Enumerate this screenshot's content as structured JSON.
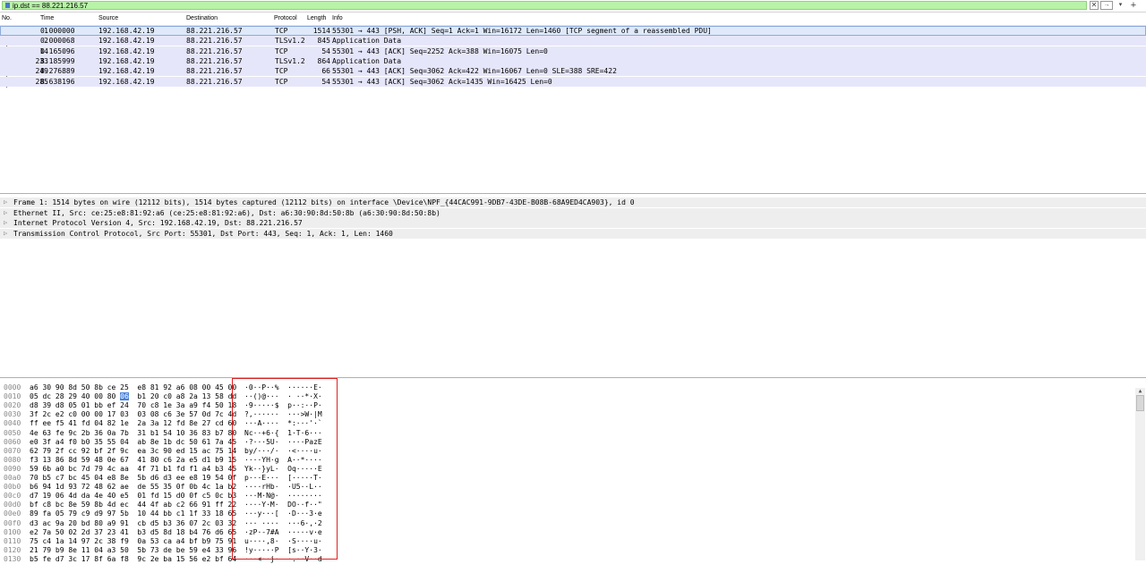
{
  "filter": {
    "value": "ip.dst == 88.221.216.57",
    "clear_label": "✕",
    "apply_label": "→",
    "dropdown_label": "▾",
    "add_label": "+"
  },
  "packet_list": {
    "headers": {
      "no": "No.",
      "time": "Time",
      "source": "Source",
      "destination": "Destination",
      "protocol": "Protocol",
      "length": "Length",
      "info": "Info"
    },
    "rows": [
      {
        "no": "1",
        "time": "0.000000",
        "source": "192.168.42.19",
        "destination": "88.221.216.57",
        "protocol": "TCP",
        "length": "1514",
        "info": "55301 → 443 [PSH, ACK] Seq=1 Ack=1 Win=16172 Len=1460 [TCP segment of a reassembled PDU]"
      },
      {
        "no": "2",
        "time": "0.000068",
        "source": "192.168.42.19",
        "destination": "88.221.216.57",
        "protocol": "TLSv1.2",
        "length": "845",
        "info": "Application Data"
      },
      {
        "no": "14",
        "time": "0.165096",
        "source": "192.168.42.19",
        "destination": "88.221.216.57",
        "protocol": "TCP",
        "length": "54",
        "info": "55301 → 443 [ACK] Seq=2252 Ack=388 Win=16075 Len=0"
      },
      {
        "no": "233",
        "time": "8.185999",
        "source": "192.168.42.19",
        "destination": "88.221.216.57",
        "protocol": "TLSv1.2",
        "length": "864",
        "info": "Application Data"
      },
      {
        "no": "249",
        "time": "8.276889",
        "source": "192.168.42.19",
        "destination": "88.221.216.57",
        "protocol": "TCP",
        "length": "66",
        "info": "55301 → 443 [ACK] Seq=3062 Ack=422 Win=16067 Len=0 SLE=388 SRE=422"
      },
      {
        "no": "285",
        "time": "8.638196",
        "source": "192.168.42.19",
        "destination": "88.221.216.57",
        "protocol": "TCP",
        "length": "54",
        "info": "55301 → 443 [ACK] Seq=3062 Ack=1435 Win=16425 Len=0"
      }
    ]
  },
  "details": [
    "Frame 1: 1514 bytes on wire (12112 bits), 1514 bytes captured (12112 bits) on interface \\Device\\NPF_{44CAC991-9DB7-43DE-B08B-68A9ED4CA903}, id 0",
    "Ethernet II, Src: ce:25:e8:81:92:a6 (ce:25:e8:81:92:a6), Dst: a6:30:90:8d:50:8b (a6:30:90:8d:50:8b)",
    "Internet Protocol Version 4, Src: 192.168.42.19, Dst: 88.221.216.57",
    "Transmission Control Protocol, Src Port: 55301, Dst Port: 443, Seq: 1, Ack: 1, Len: 1460"
  ],
  "bytes": [
    {
      "offset": "0000",
      "hex": "a6 30 90 8d 50 8b ce 25  e8 81 92 a6 08 00 45 00",
      "ascii": "·0··P··%  ······E·"
    },
    {
      "offset": "0010",
      "hex": "05 dc 28 29 40 00 80 06  b1 20 c0 a8 2a 13 58 dd",
      "ascii": "··()@···  · ··*·X·",
      "hl_byte": "06"
    },
    {
      "offset": "0020",
      "hex": "d8 39 d8 05 01 bb ef 24  70 c8 1e 3a a9 f4 50 18",
      "ascii": "·9·····$  p··:··P·"
    },
    {
      "offset": "0030",
      "hex": "3f 2c e2 c0 00 00 17 03  03 08 c6 3e 57 0d 7c 4d",
      "ascii": "?,······  ···>W·|M"
    },
    {
      "offset": "0040",
      "hex": "ff ee f5 41 fd 04 82 1e  2a 3a 12 fd 8e 27 cd 60",
      "ascii": "···A····  *:···'·`"
    },
    {
      "offset": "0050",
      "hex": "4e 63 fe 9c 2b 36 0a 7b  31 b1 54 10 36 83 b7 80",
      "ascii": "Nc··+6·{  1·T·6···"
    },
    {
      "offset": "0060",
      "hex": "e0 3f a4 f0 b0 35 55 04  ab 8e 1b dc 50 61 7a 45",
      "ascii": "·?···5U·  ····PazE"
    },
    {
      "offset": "0070",
      "hex": "62 79 2f cc 92 bf 2f 9c  ea 3c 90 ed 15 ac 75 14",
      "ascii": "by/···/·  ·<····u·"
    },
    {
      "offset": "0080",
      "hex": "f3 13 86 8d 59 48 0e 67  41 80 c6 2a e5 d1 b9 15",
      "ascii": "····YH·g  A··*····"
    },
    {
      "offset": "0090",
      "hex": "59 6b a0 bc 7d 79 4c aa  4f 71 b1 fd f1 a4 b3 45",
      "ascii": "Yk··}yL·  Oq·····E"
    },
    {
      "offset": "00a0",
      "hex": "70 b5 c7 bc 45 04 e8 8e  5b d6 d3 ee e8 19 54 0f",
      "ascii": "p···E···  [·····T·"
    },
    {
      "offset": "00b0",
      "hex": "b6 94 1d 93 72 48 62 ae  de 55 35 0f 0b 4c 1a b2",
      "ascii": "····rHb·  ·U5··L··"
    },
    {
      "offset": "00c0",
      "hex": "d7 19 06 4d da 4e 40 e5  01 fd 15 d0 0f c5 0c b3",
      "ascii": "···M·N@·  ········"
    },
    {
      "offset": "00d0",
      "hex": "bf c8 bc 8e 59 8b 4d ec  44 4f ab c2 66 91 ff 22",
      "ascii": "····Y·M·  DO··f··\""
    },
    {
      "offset": "00e0",
      "hex": "89 fa 05 79 c9 d9 97 5b  10 44 bb c1 1f 33 18 65",
      "ascii": "···y···[  ·D···3·e"
    },
    {
      "offset": "00f0",
      "hex": "d3 ac 9a 20 bd 80 a9 91  cb d5 b3 36 07 2c 03 32",
      "ascii": "··· ····  ···6·,·2"
    },
    {
      "offset": "0100",
      "hex": "e2 7a 50 02 2d 37 23 41  b3 d5 8d 18 b4 76 d6 65",
      "ascii": "·zP·-7#A  ·····v·e"
    },
    {
      "offset": "0110",
      "hex": "75 c4 1a 14 97 2c 38 f9  0a 53 ca a4 bf b9 75 91",
      "ascii": "u····,8·  ·S····u·"
    },
    {
      "offset": "0120",
      "hex": "21 79 b9 8e 11 04 a3 50  5b 73 de be 59 e4 33 96",
      "ascii": "!y·····P  [s··Y·3·"
    },
    {
      "offset": "0130",
      "hex": "b5 fe d7 3c 17 8f 6a f8  9c 2e ba 15 56 e2 bf 64",
      "ascii": "···<··j·  ·.··V··d"
    }
  ]
}
